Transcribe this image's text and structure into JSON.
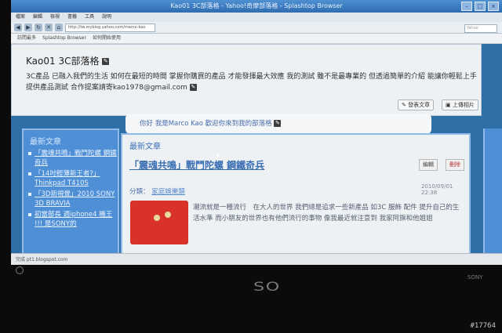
{
  "window": {
    "title": "Kao01 3C部落格 - Yahoo!奇摩部落格 - Splashtop Browser"
  },
  "menu": {
    "items": [
      "檔案",
      "編輯",
      "檢視",
      "書籤",
      "工具",
      "說明"
    ]
  },
  "navbar": {
    "url": "http://tw.myblog.yahoo.com/marco-kao",
    "search_placeholder": "Yahoo"
  },
  "bookmarks": {
    "items": [
      "訪問最多",
      "Splashtop Browser",
      "如何開始使用"
    ]
  },
  "blog": {
    "title": "Kao01 3C部落格",
    "description": "3C產品 已融入我們的生活 如何在最短的時間 掌握你購買的產品 才能發揮最大效應 我的測試 雖不是最專業的 但透過簡單的介紹 能讓你輕鬆上手 提供產品測試 合作提案請寄kao1978@gmail.com",
    "post_button": "發表文章",
    "upload_button": "上傳相片",
    "greeting": "你好 我是Marco Kao 歡迎你來到我的部落格"
  },
  "sidebar": {
    "title": "最新文章",
    "items": [
      "「震魂共鳴」戰鬥陀螺 鋼鐵奇兵",
      "「14吋輕薄新王者?」Thinkpad T410S",
      "「3D新視覺」2010 SONY 3D BRAVIA",
      "初當部長 週iphone4 機王 !!! 是SONY的"
    ]
  },
  "main": {
    "section_title": "最新文章",
    "post": {
      "title": "「震魂共鳴」戰鬥陀螺 鋼鐵奇兵",
      "edit_label": "編輯",
      "delete_label": "刪除",
      "category_label": "分類：",
      "category": "家庭娛樂類",
      "timestamp": "2010/09/01 22:38",
      "body": "潮流就是一種流行　在大人的世界 我們總是追求一些新產品 如3C 服飾 配件 提升自己的生活水準 而小朋友的世界也有他們流行的事物 像我最近就注意到 我家阿旗和他姐姐"
    }
  },
  "status": {
    "text": "完成 pt1.blogspot.com"
  },
  "bezel": {
    "logo": "SO",
    "brand": "SONY"
  },
  "watermark": "#17764"
}
